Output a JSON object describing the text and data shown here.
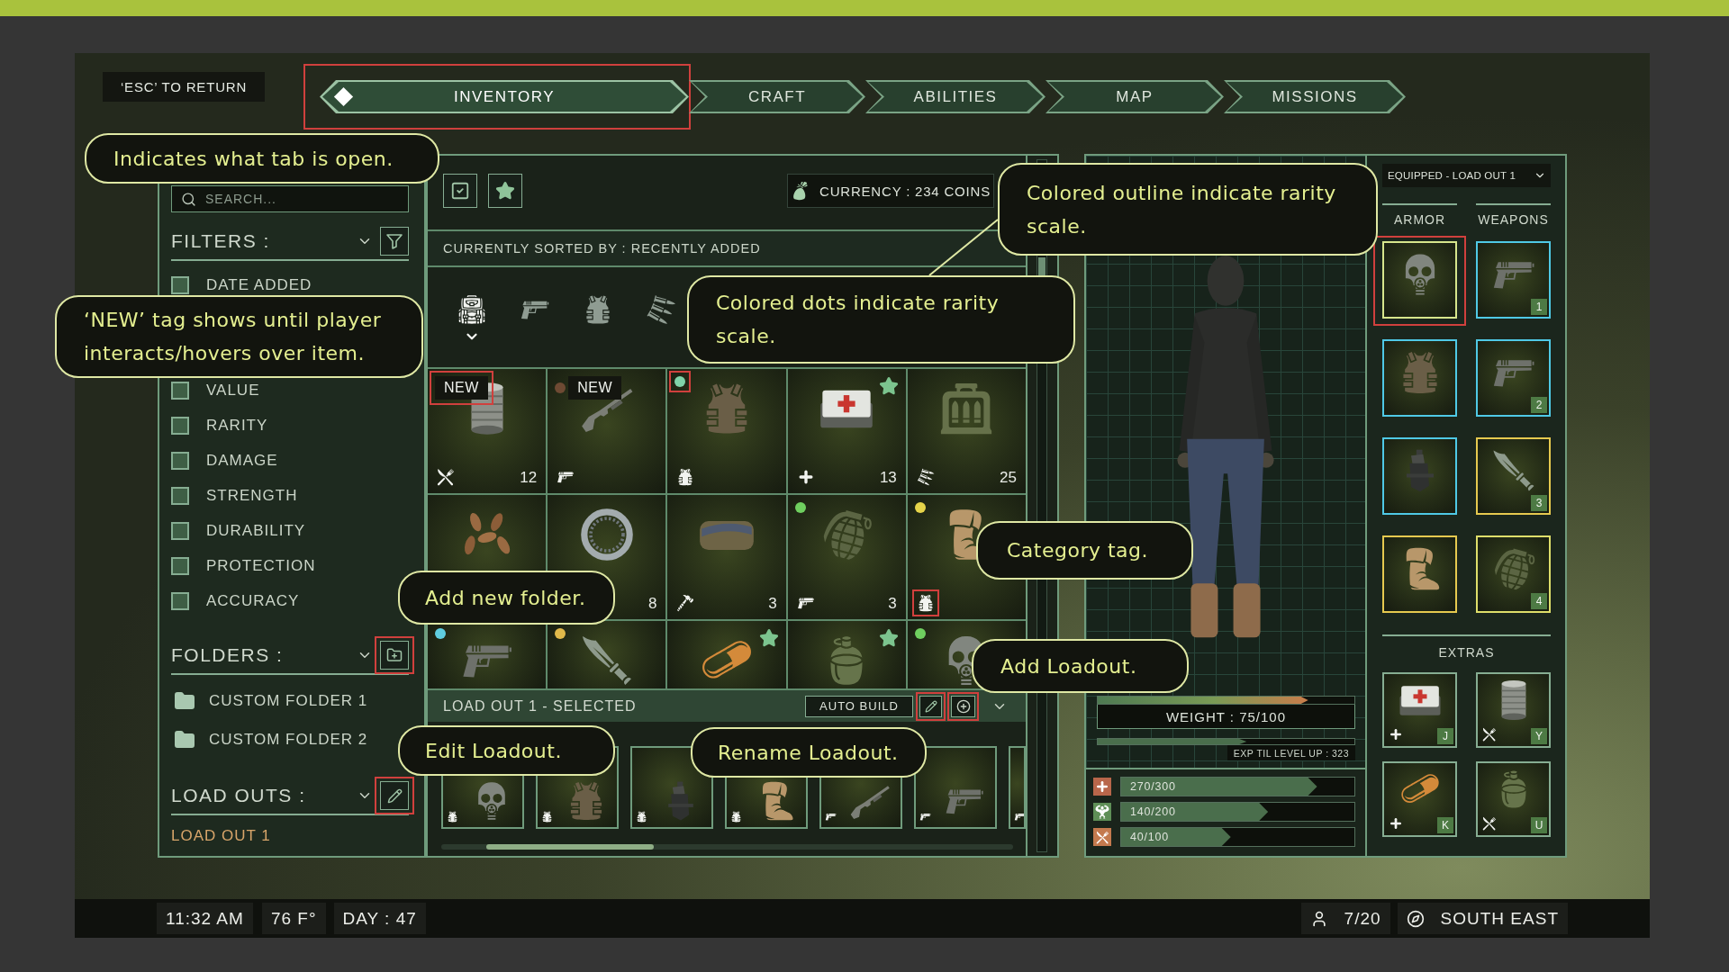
{
  "esc_hint": "‘ESC’ TO RETURN",
  "tabs": [
    {
      "label": "INVENTORY",
      "selected": true,
      "highlighted": true
    },
    {
      "label": "CRAFT",
      "selected": false,
      "highlighted": false
    },
    {
      "label": "ABILITIES",
      "selected": false,
      "highlighted": false
    },
    {
      "label": "MAP",
      "selected": false,
      "highlighted": false
    },
    {
      "label": "MISSIONS",
      "selected": false,
      "highlighted": false
    }
  ],
  "sidebar": {
    "search": {
      "placeholder": "SEARCH..."
    },
    "filters": {
      "title": "FILTERS :",
      "items": [
        {
          "label": "DATE ADDED",
          "checked": false
        },
        {
          "label": "VALUE",
          "checked": false
        },
        {
          "label": "RARITY",
          "checked": false
        },
        {
          "label": "DAMAGE",
          "checked": false
        },
        {
          "label": "STRENGTH",
          "checked": false
        },
        {
          "label": "DURABILITY",
          "checked": false
        },
        {
          "label": "PROTECTION",
          "checked": false
        },
        {
          "label": "ACCURACY",
          "checked": false
        }
      ]
    },
    "folders": {
      "title": "FOLDERS :",
      "add_button": {
        "highlighted": true
      },
      "items": [
        {
          "label": "CUSTOM FOLDER 1"
        },
        {
          "label": "CUSTOM FOLDER 2"
        }
      ]
    },
    "loadouts": {
      "title": "LOAD OUTS :",
      "edit_button": {
        "highlighted": true
      },
      "items": [
        {
          "label": "LOAD OUT 1",
          "selected": true
        }
      ]
    }
  },
  "inventory": {
    "currency": "CURRENCY : 234 COINS",
    "sort_label": "CURRENTLY SORTED BY : RECENTLY ADDED",
    "categories": [
      {
        "kind": "backpack",
        "selected": true
      },
      {
        "kind": "pistol",
        "selected": false
      },
      {
        "kind": "vest",
        "selected": false
      },
      {
        "kind": "bullets",
        "selected": false
      }
    ],
    "items": [
      {
        "kind": "can",
        "tag": {
          "text": "NEW",
          "highlighted": true
        },
        "favorite": false,
        "category": {
          "kind": "food",
          "highlighted": false
        },
        "count": "12"
      },
      {
        "kind": "shotgun",
        "dot": {
          "color": "#6e4a33",
          "highlighted": false
        },
        "tag": {
          "text": "NEW",
          "highlighted": false
        },
        "favorite": false,
        "category": {
          "kind": "weapon",
          "highlighted": false
        }
      },
      {
        "kind": "vest",
        "dot": {
          "color": "#7fd3a9",
          "highlighted": true
        },
        "favorite": false,
        "category": {
          "kind": "armor",
          "highlighted": false
        }
      },
      {
        "kind": "medkit",
        "favorite": true,
        "category": {
          "kind": "medical",
          "highlighted": false
        },
        "count": "13"
      },
      {
        "kind": "ammo_box",
        "favorite": false,
        "category": {
          "kind": "ammo",
          "highlighted": false
        },
        "count": "25"
      },
      {
        "kind": "nuts",
        "favorite": false
      },
      {
        "kind": "ring",
        "favorite": false,
        "count": "8"
      },
      {
        "kind": "blanket",
        "favorite": false,
        "category": {
          "kind": "tool",
          "highlighted": false
        },
        "count": "3"
      },
      {
        "kind": "grenade",
        "dot": {
          "color": "#6fcf5f",
          "highlighted": false
        },
        "favorite": false,
        "category": {
          "kind": "weapon",
          "highlighted": false
        },
        "count": "3"
      },
      {
        "kind": "boot",
        "dot": {
          "color": "#e6d44a",
          "highlighted": false
        },
        "favorite": false,
        "category": {
          "kind": "armor",
          "highlighted": true
        }
      },
      {
        "kind": "pistol",
        "dot": {
          "color": "#5fcde0",
          "highlighted": false
        },
        "favorite": false
      },
      {
        "kind": "knife",
        "dot": {
          "color": "#e0b84a",
          "highlighted": false
        },
        "favorite": false
      },
      {
        "kind": "pills",
        "favorite": true
      },
      {
        "kind": "canteen",
        "favorite": true
      },
      {
        "kind": "gas_mask",
        "dot": {
          "color": "#6fcf5f",
          "highlighted": false
        },
        "favorite": false
      }
    ],
    "loadout_bar": {
      "title": "LOAD OUT 1 - SELECTED",
      "auto_build": "AUTO BUILD",
      "edit_button": {
        "highlighted": true
      },
      "add_button": {
        "highlighted": true
      }
    },
    "loadout_slots": [
      {
        "kind": "gas_mask",
        "category": {
          "kind": "armor"
        }
      },
      {
        "kind": "vest",
        "category": {
          "kind": "armor"
        }
      },
      {
        "kind": "holster",
        "category": {
          "kind": "armor"
        }
      },
      {
        "kind": "boot",
        "category": {
          "kind": "armor"
        }
      },
      {
        "kind": "shotgun",
        "category": {
          "kind": "weapon"
        }
      },
      {
        "kind": "pistol",
        "category": {
          "kind": "weapon"
        }
      },
      {
        "category": {
          "kind": "weapon"
        }
      }
    ]
  },
  "character": {
    "weight": {
      "label": "WEIGHT : 75/100",
      "level": 0.82
    },
    "exp": {
      "label": "EXP TIL LEVEL UP : 323",
      "level": 0.58
    },
    "stats": [
      {
        "kind": "health",
        "color": "#b8664a",
        "value": "270/300",
        "level": 0.84
      },
      {
        "kind": "strength",
        "color": "#5f8f57",
        "value": "140/200",
        "level": 0.63
      },
      {
        "kind": "food",
        "color": "#c47a4e",
        "value": "40/100",
        "level": 0.47
      }
    ]
  },
  "equipment": {
    "dropdown": "EQUIPPED - LOAD OUT 1",
    "armor_title": "ARMOR",
    "weapons_title": "WEAPONS",
    "armor": [
      {
        "kind": "gas_mask",
        "color": "#d6e58c",
        "highlighted": true
      },
      {
        "kind": "vest",
        "color": "#4fc9e6",
        "highlighted": false
      },
      {
        "kind": "holster",
        "color": "#4fc9e6",
        "highlighted": false
      },
      {
        "kind": "boot",
        "color": "#e6c94f",
        "highlighted": false
      }
    ],
    "weapons": [
      {
        "kind": "pistol",
        "color": "#4fc9e6",
        "slot": "1"
      },
      {
        "kind": "pistol",
        "color": "#4fc9e6",
        "slot": "2"
      },
      {
        "kind": "knife",
        "color": "#e6c94f",
        "slot": "3"
      },
      {
        "kind": "grenade",
        "color": "#dede6a",
        "slot": "4"
      }
    ],
    "extras_title": "EXTRAS",
    "extras": [
      {
        "kind": "medkit",
        "category": {
          "kind": "medical"
        },
        "key": "J"
      },
      {
        "kind": "can",
        "category": {
          "kind": "food"
        },
        "key": "Y"
      },
      {
        "kind": "pills",
        "category": {
          "kind": "medical"
        },
        "key": "K"
      },
      {
        "kind": "canteen",
        "category": {
          "kind": "food"
        },
        "key": "U"
      }
    ]
  },
  "status_bar": {
    "time": "11:32 AM",
    "temperature": "76 F°",
    "day": "DAY : 47",
    "players": "7/20",
    "direction": "SOUTH EAST"
  },
  "callouts": [
    {
      "text": "Indicates what tab is open."
    },
    {
      "text": "Colored outline indicate rarity scale."
    },
    {
      "text": "Colored dots indicate rarity scale."
    },
    {
      "text": "‘NEW’ tag shows until player interacts/hovers over item."
    },
    {
      "text": "Category tag."
    },
    {
      "text": "Add new folder."
    },
    {
      "text": "Add Loadout."
    },
    {
      "text": "Edit Loadout."
    },
    {
      "text": "Rename Loadout."
    }
  ]
}
